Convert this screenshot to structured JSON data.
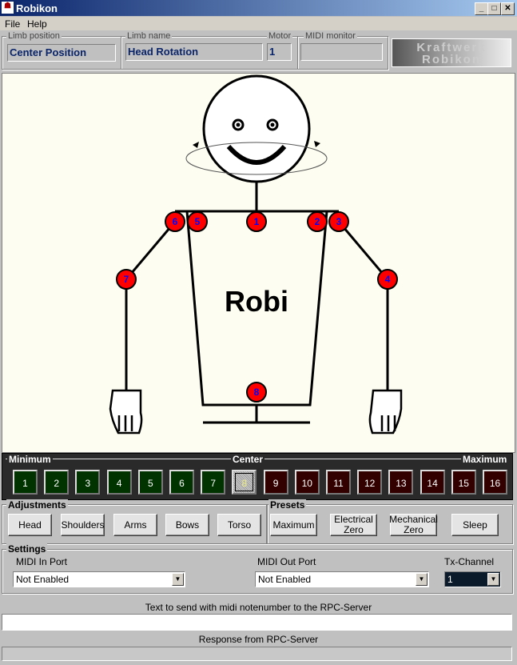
{
  "window": {
    "title": "Robikon"
  },
  "menu": [
    "File",
    "Help"
  ],
  "header": {
    "limb_position": {
      "label": "Limb position",
      "value": "Center Position"
    },
    "limb_name": {
      "label": "Limb name",
      "value": "Head Rotation"
    },
    "motor": {
      "label": "Motor",
      "value": "1"
    },
    "midi_monitor": {
      "label": "MIDI monitor",
      "value": ""
    },
    "logo": "Kraftwerk Robikon"
  },
  "robot": {
    "label": "Robi",
    "joints": [
      "1",
      "2",
      "3",
      "4",
      "5",
      "6",
      "7",
      "8"
    ]
  },
  "positions": {
    "min_label": "Minimum",
    "center_label": "Center",
    "max_label": "Maximum",
    "keys": [
      "1",
      "2",
      "3",
      "4",
      "5",
      "6",
      "7",
      "8",
      "9",
      "10",
      "11",
      "12",
      "13",
      "14",
      "15",
      "16"
    ],
    "selected": "8",
    "colors": {
      "min": "#003300",
      "center": "#c8c8c8",
      "max": "#330000"
    }
  },
  "adjustments": {
    "label": "Adjustments",
    "buttons": [
      "Head",
      "Shoulders",
      "Arms",
      "Bows",
      "Torso"
    ]
  },
  "presets": {
    "label": "Presets",
    "buttons": [
      "Maximum",
      "Electrical Zero",
      "Mechanical Zero",
      "Sleep"
    ]
  },
  "settings": {
    "label": "Settings",
    "midi_in": {
      "label": "MIDI In Port",
      "value": "Not Enabled"
    },
    "midi_out": {
      "label": "MIDI Out Port",
      "value": "Not Enabled"
    },
    "tx": {
      "label": "Tx-Channel",
      "value": "1"
    }
  },
  "rpc": {
    "text_label": "Text to send with midi notenumber to the RPC-Server",
    "text_value": "",
    "response_label": "Response from RPC-Server",
    "response_value": ""
  },
  "joint_color": "#ff0000"
}
